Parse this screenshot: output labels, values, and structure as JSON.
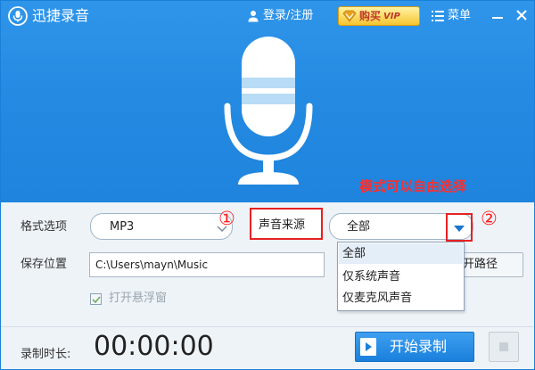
{
  "app": {
    "title": "迅捷录音"
  },
  "header": {
    "login_label": "登录/注册",
    "vip_label": "购买",
    "vip_tag": "VIP",
    "menu_label": "菜单"
  },
  "annotations": {
    "mode_note": "模式可以自由选择",
    "marker_one": "①",
    "marker_two": "②"
  },
  "form": {
    "format_label": "格式选项",
    "format_value": "MP3",
    "source_label": "声音来源",
    "source_value": "全部",
    "source_options": [
      "全部",
      "仅系统声音",
      "仅麦克风声音"
    ],
    "selected_option_index": 0,
    "save_label": "保存位置",
    "save_path": "C:\\Users\\mayn\\Music",
    "open_path_label": "开路径",
    "floating_window_label": "打开悬浮窗",
    "floating_window_checked": true
  },
  "footer": {
    "duration_label": "录制时长:",
    "timer": "00:00:00",
    "start_label": "开始录制"
  },
  "colors": {
    "primary_blue": "#2288e0",
    "annotation_red": "#ff2d2d",
    "vip_gold": "#f6c52f"
  }
}
